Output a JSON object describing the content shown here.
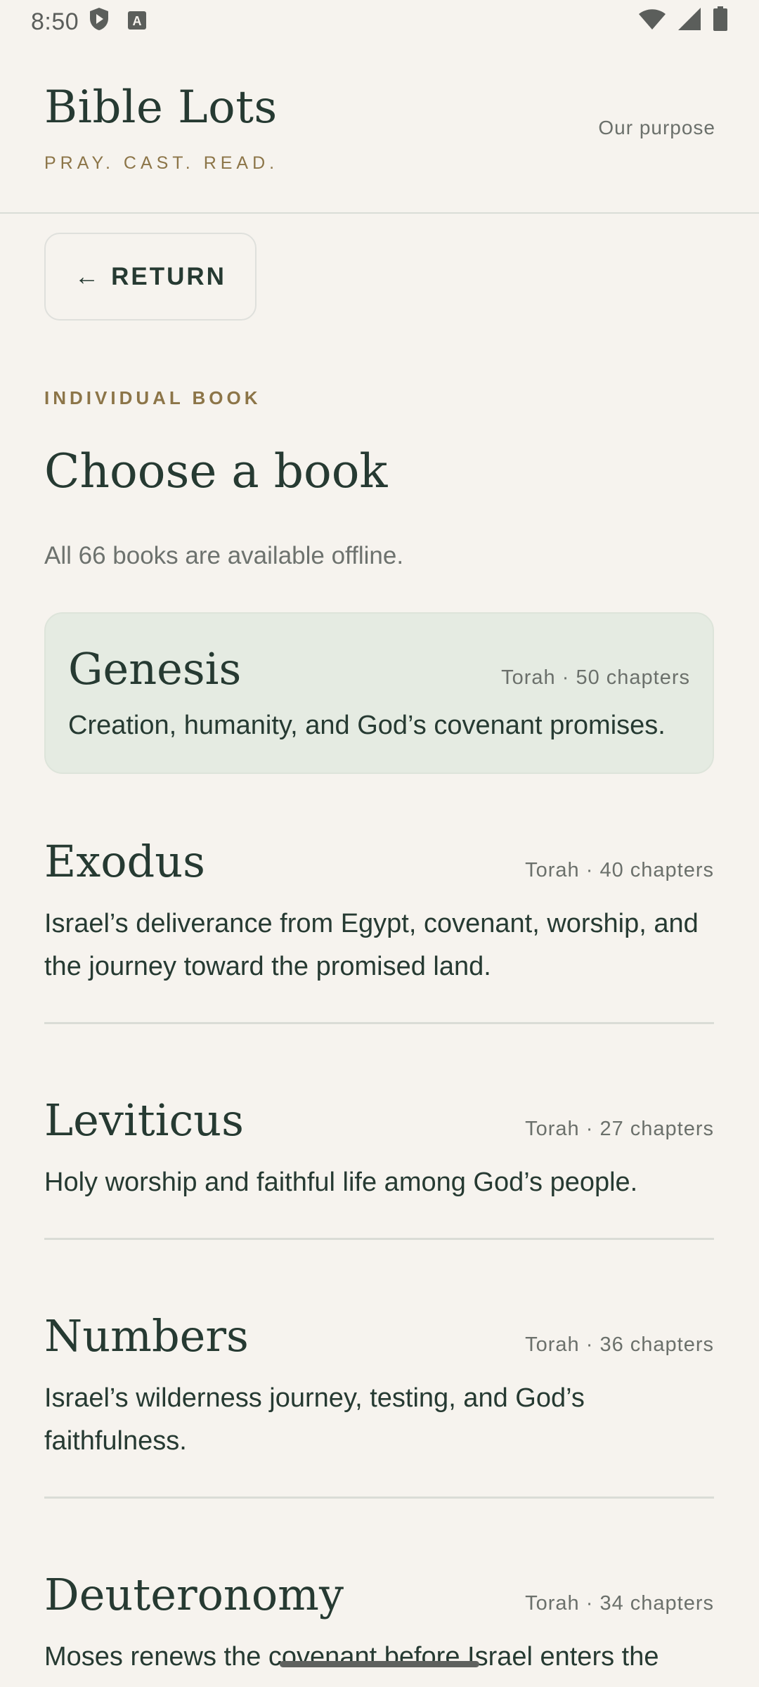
{
  "status_bar": {
    "time": "8:50",
    "icons_left": [
      "shield-play-icon",
      "keyboard-a-icon"
    ],
    "icons_right": [
      "wifi-icon",
      "signal-icon",
      "battery-icon"
    ]
  },
  "header": {
    "title": "Bible Lots",
    "tagline": "PRAY. CAST. READ.",
    "purpose_link": "Our purpose"
  },
  "return_button": {
    "arrow": "←",
    "label": "RETURN"
  },
  "section": {
    "eyebrow": "INDIVIDUAL BOOK",
    "title": "Choose a book",
    "subtitle": "All 66 books are available offline."
  },
  "books": [
    {
      "name": "Genesis",
      "meta": "Torah · 50 chapters",
      "description": "Creation, humanity, and God’s covenant promises.",
      "selected": true
    },
    {
      "name": "Exodus",
      "meta": "Torah · 40 chapters",
      "description": "Israel’s deliverance from Egypt, covenant, worship, and the journey toward the promised land.",
      "selected": false
    },
    {
      "name": "Leviticus",
      "meta": "Torah · 27 chapters",
      "description": "Holy worship and faithful life among God’s people.",
      "selected": false
    },
    {
      "name": "Numbers",
      "meta": "Torah · 36 chapters",
      "description": "Israel’s wilderness journey, testing, and God’s faithfulness.",
      "selected": false
    },
    {
      "name": "Deuteronomy",
      "meta": "Torah · 34 chapters",
      "description": "Moses renews the covenant before Israel enters the",
      "selected": false
    }
  ],
  "colors": {
    "background": "#f6f3ee",
    "accent_gold": "#8c7548",
    "text_green": "#263a32",
    "selected_card": "#e5ebe2"
  }
}
